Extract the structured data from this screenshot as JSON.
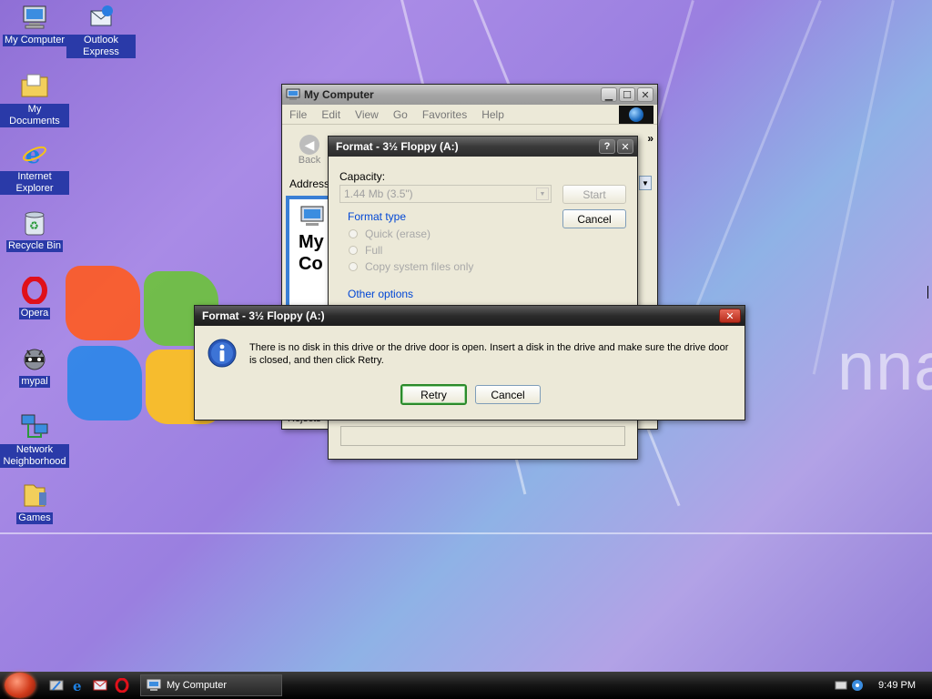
{
  "desktop": {
    "icons": [
      {
        "label": "My Computer",
        "icon": "computer-icon"
      },
      {
        "label": "Outlook Express",
        "icon": "outlook-express-icon"
      },
      {
        "label": "My Documents",
        "icon": "folder-icon"
      },
      {
        "label": "Internet Explorer",
        "icon": "internet-explorer-icon"
      },
      {
        "label": "Recycle Bin",
        "icon": "recycle-bin-icon"
      },
      {
        "label": "Opera",
        "icon": "opera-icon"
      },
      {
        "label": "mypal",
        "icon": "mypal-icon"
      },
      {
        "label": "Network Neighborhood",
        "icon": "network-icon"
      },
      {
        "label": "Games",
        "icon": "games-folder-icon"
      }
    ],
    "wallpaper_text": "nna",
    "wallpaper_tm": "TM"
  },
  "my_computer": {
    "title": "My Computer",
    "menu": [
      "File",
      "Edit",
      "View",
      "Go",
      "Favorites",
      "Help"
    ],
    "back_label": "Back",
    "address_label": "Address",
    "chevron": "»",
    "pane_title_1": "My",
    "pane_title_2": "Co",
    "status_text": "Rejects"
  },
  "format_dialog": {
    "title": "Format - 3½ Floppy (A:)",
    "help": "?",
    "close": "✕",
    "capacity_label": "Capacity:",
    "capacity_value": "1.44 Mb (3.5\")",
    "start_label": "Start",
    "cancel_label": "Cancel",
    "format_type_label": "Format type",
    "options": [
      "Quick (erase)",
      "Full",
      "Copy system files only"
    ],
    "other_options_label": "Other options"
  },
  "error_dialog": {
    "title": "Format - 3½ Floppy (A:)",
    "close": "✕",
    "message": "There is no disk in this drive or the drive door is open. Insert a disk in the drive and make sure the drive door is closed, and then click Retry.",
    "retry_label": "Retry",
    "cancel_label": "Cancel",
    "icon": "info-icon"
  },
  "taskbar": {
    "quick_launch": [
      "show-desktop-icon",
      "internet-explorer-icon",
      "outlook-icon",
      "opera-icon"
    ],
    "task_label": "My Computer",
    "clock": "9:49 PM"
  },
  "colors": {
    "accent": "#0046d5",
    "label_bg": "#2a3aa8",
    "default_button": "#2b8a2b"
  }
}
